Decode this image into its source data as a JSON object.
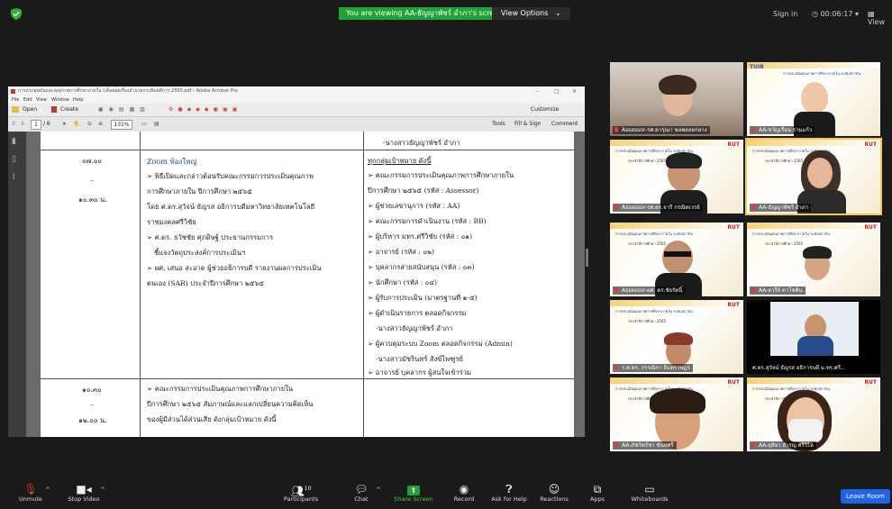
{
  "top": {
    "banner": "You are viewing AA-ธัญญาพัชร์ อำภา's screen",
    "view_options": "View Options",
    "view_options_caret": "⌄",
    "sign_in": "Sign in",
    "timer": "00:06:17",
    "view": "View",
    "accent_green": "#1fa33a"
  },
  "acrobat": {
    "title": "การแระชุมมันและคุณภาพการศึกษาภายใน (เต็มยอดเรื่องอำนวยกระหึมคดีการ 2565.pdf - Adobe Acrobat Pro",
    "menu": [
      "File",
      "Edit",
      "View",
      "Window",
      "Help"
    ],
    "open": "Open",
    "create": "Create",
    "customize": "Customize",
    "page_num": "1",
    "page_total": "/ 6",
    "zoom": "131%",
    "tools": "Tools",
    "fill_sign": "Fill & Sign",
    "comment": "Comment"
  },
  "doc": {
    "top_right": "-นางสาวธัญญาพัชร์  อำภา",
    "row1": {
      "time_start": "๐๗.๐๐",
      "dash": "–",
      "time_end": "๑๐.๓๐ น.",
      "left": [
        "Zoom ห้องใหญ่",
        "➢ พิธีเปิดและกล่าวต้อนรับคณะกรรมการประเมินคุณภาพ",
        "การศึกษาภายใน ปีการศึกษา ๒๕๖๕",
        "โดย ศ.ดร.สุวัจน์  ธัญรส อธิการบดีมหาวิทยาลัยเทคโนโลยี",
        "ราชมงคลศรีวิชัย",
        "➢ ศ.ดร. ธวัชชัย  ศุภดิษฐ์ ประธานกรรมการ",
        "ชี้แจงวัตถุประสงค์การประเมินฯ",
        "➢ ผศ. เสนอ  สะอาด ผู้ช่วยอธิการบดี รายงานผลการประเมิน",
        "ตนเอง (SAR) ประจำปีการศึกษา ๒๕๖๕"
      ],
      "right_head": "ทุกกลุ่มเป้าหมาย ดังนี้",
      "right": [
        "➢ คณะกรรมการประเมินคุณภาพการศึกษาภายใน",
        "ปีการศึกษา ๒๕๖๕ (รหัส : Assessor)",
        "➢ ผู้ช่วยเลขานุการ (รหัส : AA)",
        "➢ คณะกรรมการดำเนินงาน (รหัส : BB)",
        "➢ ผู้บริหาร มทร.ศรีวิชัย (รหัส : ๐๑)",
        "➢ อาจารย์ (รหัส : ๐๒)",
        "➢ บุคลากรสายสนับสนุน (รหัส : ๐๓)",
        "➢ นักศึกษา (รหัส : ๐๔)",
        "➢ ผู้รับการประเมิน (มาตรฐานที่ ๑-๕)",
        "➢ ผู้ดำเนินรายการ ตลอดกิจกรรม",
        "-นางสาวธัญญาพัชร์  อำภา",
        "➢ ผู้ควบคุมระบบ Zoom ตลอดกิจกรรม (Admin)",
        "-นางสาวมัชรินทร์  สังข์ไพฑูรย์",
        "➢ อาจารย์ บุคลากร ผู้สนใจเข้าร่วม"
      ]
    },
    "row2": {
      "time_start": "๑๐.๓๐",
      "dash": "–",
      "time_end": "๑๒.๐๐ น.",
      "left": [
        "➢ คณะกรรมการประเมินคุณภาพการศึกษาภายใน",
        "ปีการศึกษา ๒๕๖๕  สัมภาษณ์และแลกเปลี่ยนความคิดเห็น",
        "ของผู้มีส่วนได้ส่วนเสีย  ดังกลุ่มเป้าหมาย ดังนี้"
      ]
    }
  },
  "participants": [
    {
      "name": "Assessor-รศ.ดารุณา ขอพลอยกลาง"
    },
    {
      "name": "AA-ขวัญเรือน  รามแก้ว"
    },
    {
      "name": "Assessor-รศ.ดร.จารี กรณิทเวรย์"
    },
    {
      "name": "AA-ธัญญาพัชร์  อำภา"
    },
    {
      "name": "Assessor-ผศ. ดร.ชัยรัตนิ์"
    },
    {
      "name": "AA-อารีย์ ดาโชติน"
    },
    {
      "name": "ร.ศ.ดร. กรรณิกา อินทราษฎร"
    },
    {
      "name": "ศ.ดร.สุวัจน์ ธัญรส อธิการบดี ม.ทร.ศรี..."
    },
    {
      "name": "AA-ภัชวัชร์ชา ขันทศรี"
    },
    {
      "name": "AA-ยุสิยา สำรญ ศรีวิไล"
    }
  ],
  "slide": {
    "title": "การประเมินคุณภาพการศึกษาภายใน ระดับสถาบัน",
    "year": "ประจำปีการศึกษา 2565",
    "logo": "RUT",
    "tile2_logo": "TUIR"
  },
  "toolbar": {
    "unmute": "Unmute",
    "stop_video": "Stop Video",
    "participants": "Participants",
    "participants_count": "10",
    "chat": "Chat",
    "share_screen": "Share Screen",
    "record": "Record",
    "ask_help": "Ask for Help",
    "reactions": "Reactions",
    "apps": "Apps",
    "whiteboards": "Whiteboards",
    "leave": "Leave Room",
    "caret": "^"
  }
}
